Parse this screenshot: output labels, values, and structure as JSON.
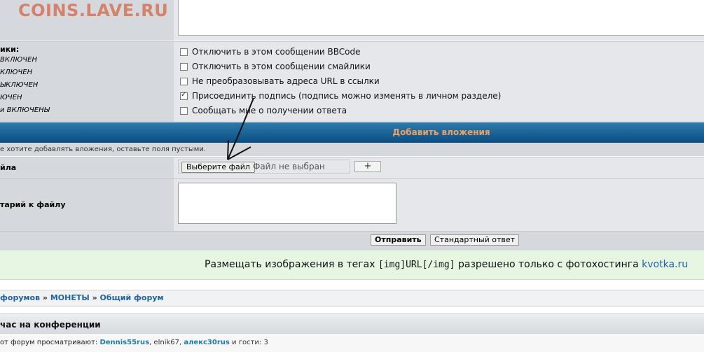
{
  "watermark": "COINS.LAVE.RU",
  "options_panel": {
    "title": "ики:",
    "states": [
      "ВКЛЮЧЕН",
      "КЛЮЧЕН",
      "ЫКЛЮЧЕН",
      "ЮЧЕН",
      "и ВКЛЮЧЕНЫ"
    ],
    "checkboxes": [
      {
        "label": "Отключить в этом сообщении BBCode",
        "checked": false
      },
      {
        "label": "Отключить в этом сообщении смайлики",
        "checked": false
      },
      {
        "label": "Не преобразовывать адреса URL в ссылки",
        "checked": false
      },
      {
        "label": "Присоединить подпись (подпись можно изменять в личном разделе)",
        "checked": true
      },
      {
        "label": "Сообщать мне о получении ответа",
        "checked": false
      }
    ]
  },
  "attachments": {
    "header": "Добавить вложения",
    "info": "е хотите добавлять вложения, оставьте поля пустыми.",
    "file_label": "йла",
    "choose_button": "Выберите файл",
    "no_file": "Файл не выбран",
    "plus_button": "+",
    "comment_label": "тарий к файлу"
  },
  "buttons": {
    "submit": "Отправить",
    "standard_reply": "Стандартный ответ"
  },
  "notice": {
    "text_before": "Размещать изображения в тегах ",
    "tag": "[img]URL[/img]",
    "text_after": " разрешено только с фотохостинга ",
    "link": "kvotka.ru"
  },
  "breadcrumb": {
    "items": [
      "форумов",
      "МОНЕТЫ",
      "Общий форум"
    ],
    "separator": "»"
  },
  "online": {
    "title": "час на конференции",
    "prefix": "от форум просматривают: ",
    "users": [
      "Dennis55rus",
      "elnik67",
      "алекс30rus"
    ],
    "guests_text": "и гости: 3"
  }
}
